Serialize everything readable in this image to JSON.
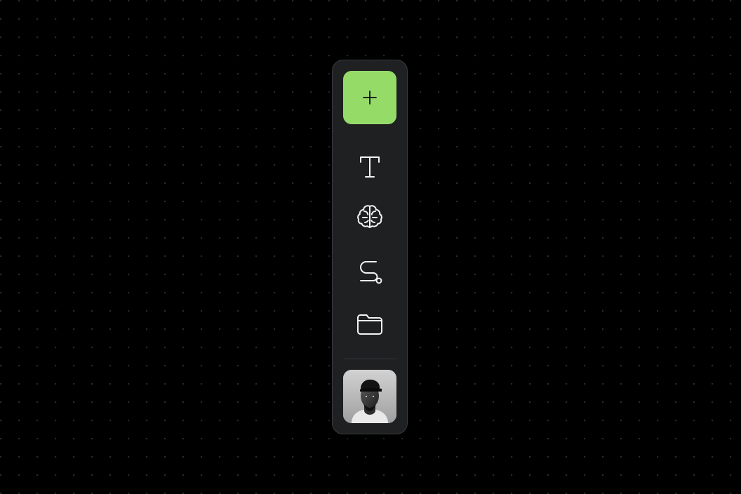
{
  "theme": {
    "background": "#000000",
    "grid_dot": "#2a2b2d",
    "toolbar_bg": "#1f2022",
    "toolbar_border": "#3a3b3e",
    "accent": "#95db68",
    "icon_color": "#f3f3f3"
  },
  "toolbar": {
    "items": [
      {
        "name": "add",
        "icon": "plus-icon",
        "active": true
      },
      {
        "name": "text",
        "icon": "text-icon"
      },
      {
        "name": "ai",
        "icon": "brain-icon"
      },
      {
        "name": "flow",
        "icon": "route-icon"
      },
      {
        "name": "files",
        "icon": "folder-icon"
      }
    ],
    "user": {
      "avatar": "user-avatar"
    }
  }
}
